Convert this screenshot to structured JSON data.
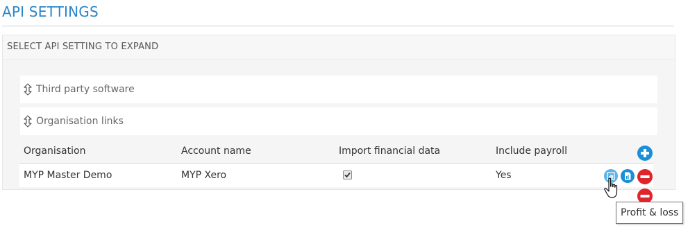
{
  "page": {
    "title": "API SETTINGS"
  },
  "panel": {
    "header": "SELECT API SETTING TO EXPAND"
  },
  "sections": [
    {
      "label": "Third party software"
    },
    {
      "label": "Organisation links"
    }
  ],
  "organisation_links": {
    "columns": [
      "Organisation",
      "Account name",
      "Import financial data",
      "Include payroll"
    ],
    "rows": [
      {
        "organisation": "MYP Master Demo",
        "account_name": "MYP Xero",
        "import_financial_data": true,
        "include_payroll": "Yes"
      }
    ]
  },
  "actions": {
    "add_icon": "plus-circle-icon",
    "profit_loss_icon": "profit-loss-report-icon",
    "balance_sheet_icon": "report-document-icon",
    "remove_icon": "minus-circle-icon"
  },
  "tooltip": {
    "text": "Profit & loss"
  },
  "colors": {
    "title": "#2a86c9",
    "accent_blue": "#1a8fd6",
    "danger_red": "#e0242b"
  }
}
